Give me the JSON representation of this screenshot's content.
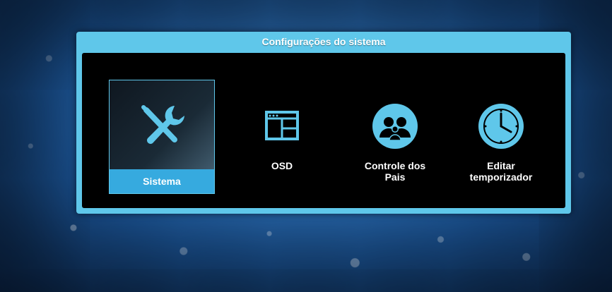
{
  "menu": {
    "title": "Configurações do sistema",
    "items": [
      {
        "label": "Sistema",
        "icon": "tools-icon",
        "selected": true
      },
      {
        "label": "OSD",
        "icon": "window-layout-icon",
        "selected": false
      },
      {
        "label": "Controle dos\nPais",
        "icon": "parental-people-icon",
        "selected": false
      },
      {
        "label": "Editar\ntemporizador",
        "icon": "clock-icon",
        "selected": false
      }
    ]
  },
  "nav": {
    "left_arrow": "«",
    "right_arrow": "»"
  },
  "colors": {
    "accent": "#5fc7ea",
    "selected_bar": "#36aadf",
    "panel_bg": "#000000",
    "text": "#ffffff"
  }
}
